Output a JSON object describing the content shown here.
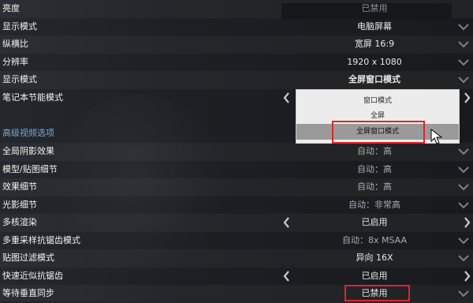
{
  "settings": [
    {
      "label": "亮度",
      "value": "已禁用",
      "control": "disabled"
    },
    {
      "label": "显示模式",
      "value": "电脑屏幕",
      "control": "dropdown"
    },
    {
      "label": "纵横比",
      "value": "宽屏 16:9",
      "control": "dropdown"
    },
    {
      "label": "分辨率",
      "value": "1920 x 1080",
      "control": "dropdown"
    },
    {
      "label": "显示模式",
      "value": "全屏窗口模式",
      "control": "dropdown"
    },
    {
      "label": "笔记本节能模式",
      "value": "",
      "control": "arrows"
    }
  ],
  "dropdown": {
    "options": [
      "窗口模式",
      "全屏",
      "全屏窗口模式"
    ],
    "selected_index": 2
  },
  "advanced": {
    "section_title": "高级视频选项",
    "items": [
      {
        "label": "全局阴影效果",
        "value": "自动：高",
        "control": "dropdown"
      },
      {
        "label": "模型/贴图细节",
        "value": "自动：高",
        "control": "dropdown"
      },
      {
        "label": "效果细节",
        "value": "自动：高",
        "control": "dropdown"
      },
      {
        "label": "光影细节",
        "value": "自动：非常高",
        "control": "dropdown"
      },
      {
        "label": "多核渲染",
        "value": "已启用",
        "control": "arrows"
      },
      {
        "label": "多重采样抗锯齿模式",
        "value": "自动：8x MSAA",
        "control": "dropdown"
      },
      {
        "label": "贴图过滤模式",
        "value": "异向 16X",
        "control": "dropdown"
      },
      {
        "label": "快速近似抗锯齿",
        "value": "已启用",
        "control": "arrows"
      },
      {
        "label": "等待垂直同步",
        "value": "已禁用",
        "control": "dropdown"
      }
    ]
  },
  "colors": {
    "highlight": "#e0242b",
    "section": "#7fa6c8",
    "dropdown_bg": "#ececec",
    "selected_option": "#9a9a9a"
  },
  "icons": {
    "dropdown": "chevron-down-icon",
    "prev": "chevron-left-icon",
    "next": "chevron-right-icon",
    "pointer": "mouse-cursor-icon"
  }
}
